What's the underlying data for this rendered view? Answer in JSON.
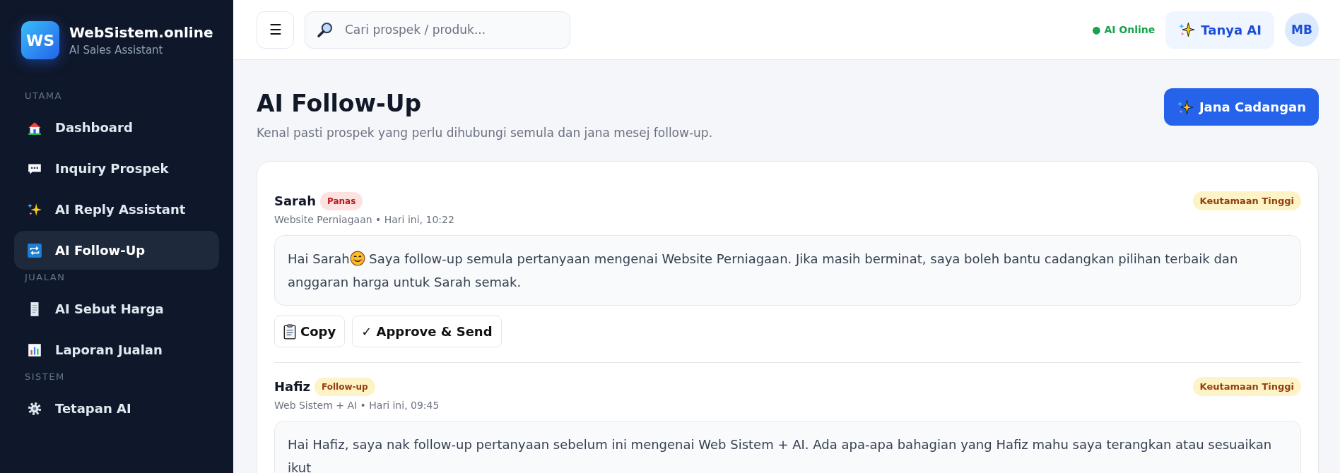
{
  "brand": {
    "logo": "WS",
    "name": "WebSistem.online",
    "tagline": "AI Sales Assistant"
  },
  "sidebar": {
    "sections": [
      {
        "label": "UTAMA",
        "items": [
          {
            "label": "Dashboard",
            "selected": false
          },
          {
            "label": "Inquiry Prospek",
            "selected": false
          },
          {
            "label": "AI Reply Assistant",
            "selected": false
          },
          {
            "label": "AI Follow-Up",
            "selected": true
          }
        ]
      },
      {
        "label": "JUALAN",
        "items": [
          {
            "label": "AI Sebut Harga",
            "selected": false
          },
          {
            "label": "Laporan Jualan",
            "selected": false
          }
        ]
      },
      {
        "label": "SISTEM",
        "items": [
          {
            "label": "Tetapan AI",
            "selected": false
          }
        ]
      }
    ]
  },
  "topbar": {
    "menu": "☰",
    "search": {
      "placeholder": "Cari prospek / produk..."
    },
    "status": "● AI Online",
    "ask_button": "Tanya AI",
    "avatar": "MB"
  },
  "page": {
    "title": "AI Follow-Up",
    "subtitle": "Kenal pasti prospek yang perlu dihubungi semula dan jana mesej follow-up.",
    "action": "Jana Cadangan"
  },
  "followups": [
    {
      "name": "Sarah",
      "tag": {
        "label": "Panas",
        "color": "#fee2e2"
      },
      "meta": "Website Perniagaan • Hari ini, 10:22",
      "priority": "Keutamaan Tinggi",
      "lead": "Hai Sarah",
      "message": "Saya follow-up semula pertanyaan mengenai Website Perniagaan. Jika masih berminat, saya boleh bantu cadangkan pilihan terbaik dan anggaran harga untuk Sarah semak.",
      "actions": [
        {
          "kind": "copy",
          "label": "Copy"
        },
        {
          "kind": "send",
          "label": "✓ Approve & Send"
        }
      ]
    },
    {
      "name": "Hafiz",
      "tag": {
        "label": "Follow-up",
        "color": "#fef3c7"
      },
      "meta": "Web Sistem + AI • Hari ini, 09:45",
      "priority": "Keutamaan Tinggi",
      "message": "Hai Hafiz, saya nak follow-up pertanyaan sebelum ini mengenai Web Sistem + AI. Ada apa-apa bahagian yang Hafiz mahu saya terangkan atau sesuaikan ikut"
    }
  ]
}
